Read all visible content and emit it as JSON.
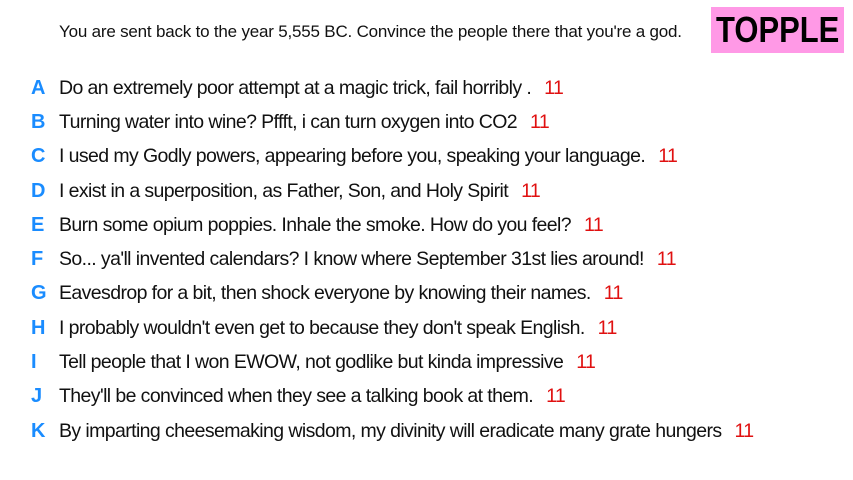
{
  "prompt": "You are sent back to the year 5,555 BC. Convince the people there that you're a god.",
  "badge": {
    "label": "TOPPLE",
    "color": "#ff99e6"
  },
  "colors": {
    "letter": "#1a8cff",
    "count": "#e01010",
    "text": "#111111"
  },
  "responses": [
    {
      "letter": "A",
      "text": "Do an extremely poor attempt at a magic trick, fail horribly .",
      "count": "11"
    },
    {
      "letter": "B",
      "text": "Turning water into wine? Pffft, i can turn oxygen into CO2",
      "count": "11"
    },
    {
      "letter": "C",
      "text": "I used my Godly powers, appearing before you, speaking your language.",
      "count": "11"
    },
    {
      "letter": "D",
      "text": "I exist in a superposition, as Father, Son, and Holy Spirit",
      "count": "11"
    },
    {
      "letter": "E",
      "text": "Burn some opium poppies. Inhale the smoke. How do you feel?",
      "count": "11"
    },
    {
      "letter": "F",
      "text": "So... ya'll invented calendars? I know where September 31st lies around!",
      "count": "11"
    },
    {
      "letter": "G",
      "text": "Eavesdrop for a bit, then shock everyone by knowing their names.",
      "count": "11"
    },
    {
      "letter": "H",
      "text": "I probably wouldn't even get to because they don't speak English.",
      "count": "11"
    },
    {
      "letter": "I",
      "text": "Tell people that I won EWOW, not godlike but kinda impressive",
      "count": "11"
    },
    {
      "letter": "J",
      "text": "They'll be convinced when they see a talking book at them.",
      "count": "11"
    },
    {
      "letter": "K",
      "text": "By imparting cheesemaking wisdom, my divinity will eradicate many grate hungers",
      "count": "11"
    }
  ]
}
